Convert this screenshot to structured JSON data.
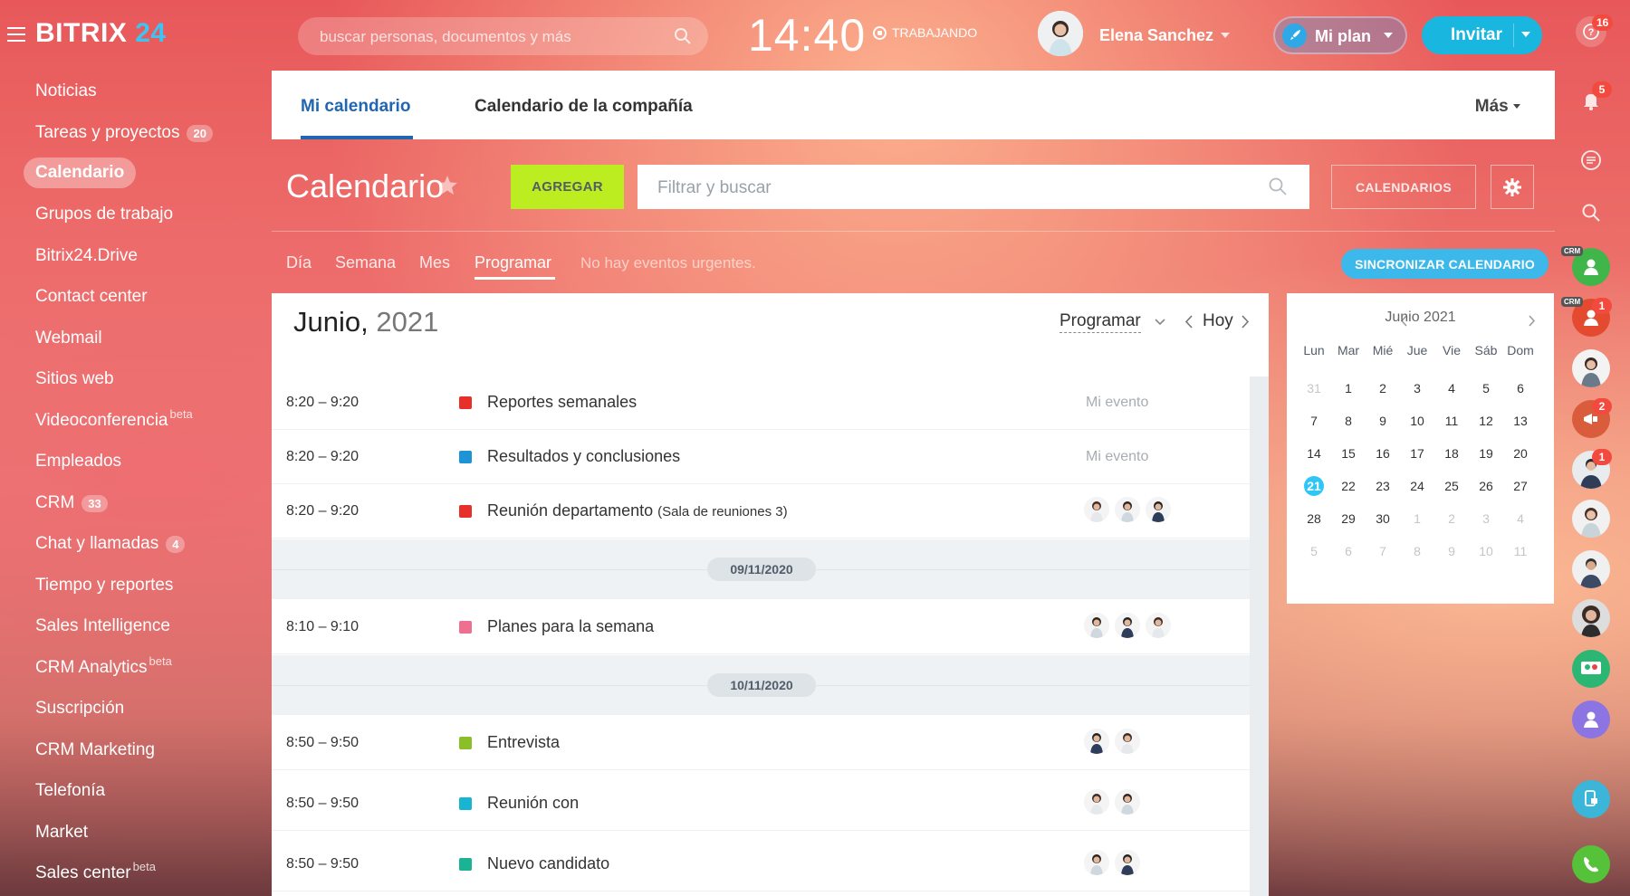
{
  "topbar": {
    "logo_main": "BITRIX",
    "logo_num": "24",
    "search_placeholder": "buscar personas, documentos y más",
    "clock": "14:40",
    "status": "TRABAJANDO",
    "user_name": "Elena Sanchez",
    "plan_label": "Mi plan",
    "invite_label": "Invitar"
  },
  "leftnav": {
    "items": [
      {
        "label": "Noticias",
        "badge": "",
        "sup": ""
      },
      {
        "label": "Tareas y proyectos",
        "badge": "20",
        "sup": ""
      },
      {
        "label": "Calendario",
        "badge": "",
        "sup": "",
        "active": true
      },
      {
        "label": "Grupos de trabajo",
        "badge": "",
        "sup": ""
      },
      {
        "label": "Bitrix24.Drive",
        "badge": "",
        "sup": ""
      },
      {
        "label": "Contact center",
        "badge": "",
        "sup": ""
      },
      {
        "label": "Webmail",
        "badge": "",
        "sup": ""
      },
      {
        "label": "Sitios web",
        "badge": "",
        "sup": ""
      },
      {
        "label": "Videoconferencia",
        "badge": "",
        "sup": "beta"
      },
      {
        "label": "Empleados",
        "badge": "",
        "sup": ""
      },
      {
        "label": "CRM",
        "badge": "33",
        "sup": ""
      },
      {
        "label": "Chat y llamadas",
        "badge": "4",
        "sup": ""
      },
      {
        "label": "Tiempo y reportes",
        "badge": "",
        "sup": ""
      },
      {
        "label": "Sales Intelligence",
        "badge": "",
        "sup": ""
      },
      {
        "label": "CRM Analytics",
        "badge": "",
        "sup": "beta"
      },
      {
        "label": "Suscripción",
        "badge": "",
        "sup": ""
      },
      {
        "label": "CRM Marketing",
        "badge": "",
        "sup": ""
      },
      {
        "label": "Telefonía",
        "badge": "",
        "sup": ""
      },
      {
        "label": "Market",
        "badge": "",
        "sup": ""
      },
      {
        "label": "Sales center",
        "badge": "",
        "sup": "beta"
      }
    ]
  },
  "rightstrip": {
    "help_badge": "16",
    "bell_badge": "5",
    "crm_tag": "CRM",
    "crm2_badge": "1",
    "megaphone_badge": "2",
    "user3_badge": "1"
  },
  "tabs": {
    "my_calendar": "Mi calendario",
    "company_calendar": "Calendario de la compañía",
    "more": "Más"
  },
  "toolbar": {
    "title": "Calendario",
    "add_label": "AGREGAR",
    "filter_placeholder": "Filtrar y buscar",
    "calendars_label": "CALENDARIOS"
  },
  "views": {
    "day": "Día",
    "week": "Semana",
    "month": "Mes",
    "schedule": "Programar",
    "urgent": "No hay eventos urgentes.",
    "sync_label": "SINCRONIZAR CALENDARIO"
  },
  "main": {
    "month": "Junio,",
    "year": "2021",
    "view_select": "Programar",
    "today": "Hoy"
  },
  "events": [
    {
      "time": "8:20 – 9:20",
      "title": "Reportes semanales",
      "extra": "",
      "color": "#e8302b",
      "owner": "Mi evento",
      "avatars": 0
    },
    {
      "time": "8:20 – 9:20",
      "title": "Resultados y conclusiones",
      "extra": "",
      "color": "#1e94d6",
      "owner": "Mi evento",
      "avatars": 0
    },
    {
      "time": "8:20 – 9:20",
      "title": "Reunión departamento",
      "extra": "(Sala de reuniones 3)",
      "color": "#e8302b",
      "owner": "",
      "avatars": 3
    },
    {
      "time": "8:10 – 9:10",
      "title": "Planes para la semana",
      "extra": "",
      "color": "#ef6f91",
      "owner": "",
      "avatars": 3
    },
    {
      "time": "8:50 – 9:50",
      "title": "Entrevista",
      "extra": "",
      "color": "#8bbf28",
      "owner": "",
      "avatars": 2
    },
    {
      "time": "8:50 – 9:50",
      "title": "Reunión con",
      "extra": "",
      "color": "#17b5d2",
      "owner": "",
      "avatars": 2
    },
    {
      "time": "8:50 – 9:50",
      "title": "Nuevo candidato",
      "extra": "",
      "color": "#1ab394",
      "owner": "",
      "avatars": 2
    }
  ],
  "day_separators": [
    "09/11/2020",
    "10/11/2020"
  ],
  "mini_calendar": {
    "title": "Junio 2021",
    "weekdays": [
      "Lun",
      "Mar",
      "Mié",
      "Jue",
      "Vie",
      "Sáb",
      "Dom"
    ],
    "weeks": [
      [
        "31",
        "1",
        "2",
        "3",
        "4",
        "5",
        "6"
      ],
      [
        "7",
        "8",
        "9",
        "10",
        "11",
        "12",
        "13"
      ],
      [
        "14",
        "15",
        "16",
        "17",
        "18",
        "19",
        "20"
      ],
      [
        "21",
        "22",
        "23",
        "24",
        "25",
        "26",
        "27"
      ],
      [
        "28",
        "29",
        "30",
        "1",
        "2",
        "3",
        "4"
      ],
      [
        "5",
        "6",
        "7",
        "8",
        "9",
        "10",
        "11"
      ]
    ],
    "today": "21"
  },
  "colors": {
    "accent": "#2066b0",
    "add_button": "#bbed21",
    "sync_button": "#3cb8ea",
    "invite_button": "#19b7e0"
  }
}
